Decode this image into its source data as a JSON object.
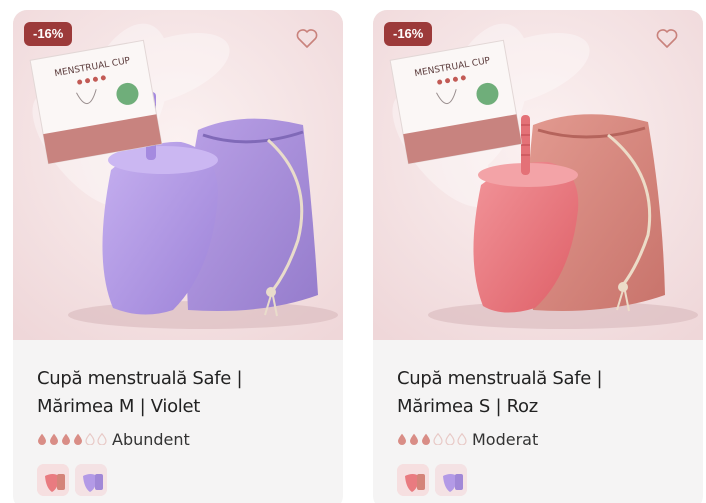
{
  "products": [
    {
      "badge": "-16%",
      "title": "Cupă menstruală Safe | Mărimea M | Violet",
      "rating_filled": 4,
      "rating_total": 6,
      "rating_label": "Abundent",
      "box_text": "MENSTRUAL CUP",
      "cup_color": "#b49ae6",
      "bag_color": "#a58ad6",
      "background": "#f3e4e6",
      "swatches": [
        "pink-cup-swatch",
        "violet-cup-swatch"
      ]
    },
    {
      "badge": "-16%",
      "title": "Cupă menstruală Safe | Mărimea S | Roz",
      "rating_filled": 3,
      "rating_total": 6,
      "rating_label": "Moderat",
      "box_text": "MENSTRUAL CUP",
      "cup_color": "#ea7b7f",
      "bag_color": "#d9837a",
      "background": "#f3e4e6",
      "swatches": [
        "pink-cup-swatch",
        "violet-cup-swatch"
      ]
    }
  ],
  "colors": {
    "badge": "#9c3a3a",
    "drop_filled": "#d98d86",
    "drop_empty": "#e8c9c6",
    "card_bg": "#f5f4f4"
  },
  "icons": {
    "wishlist": "heart-outline-icon",
    "rating": "water-drop-icon"
  }
}
